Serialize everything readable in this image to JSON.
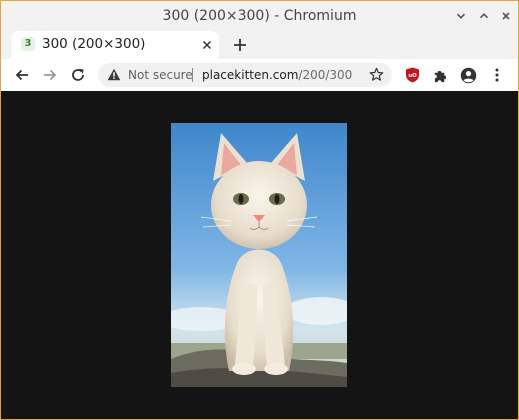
{
  "window": {
    "title": "300 (200×300) - Chromium"
  },
  "tab": {
    "title": "300 (200×300)",
    "favicon_glyph": "3"
  },
  "address_bar": {
    "security_label": "Not secure",
    "url_domain": "placekitten.com",
    "url_path": "/200/300"
  },
  "page": {
    "image_alt": "kitten"
  },
  "colors": {
    "accent_border": "#e8a33a",
    "ublock_red": "#c0181e",
    "content_bg": "#141414"
  },
  "icons": [
    "chevron-down-icon",
    "chevron-up-icon",
    "close-icon",
    "back-arrow-icon",
    "forward-arrow-icon",
    "reload-icon",
    "warning-icon",
    "star-icon",
    "ublock-icon",
    "puzzle-icon",
    "profile-icon",
    "kebab-menu-icon"
  ]
}
